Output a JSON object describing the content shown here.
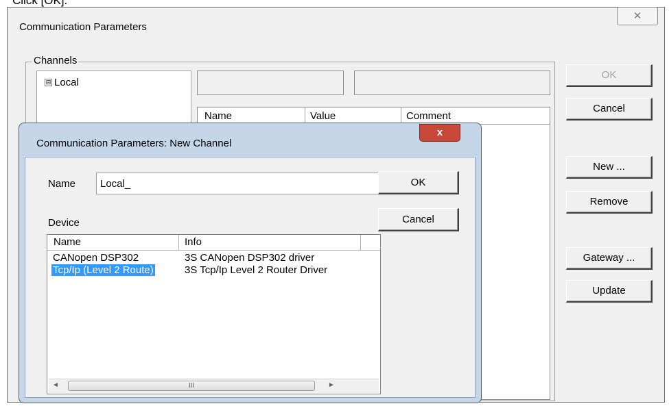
{
  "caption": "Click [OK].",
  "main_dialog": {
    "title": "Communication Parameters",
    "close_glyph": "✕",
    "channels_group_label": "Channels",
    "tree": {
      "expand_glyph": "⊟",
      "root": "Local"
    },
    "params_columns": [
      "Name",
      "Value",
      "Comment"
    ],
    "buttons": {
      "ok": "OK",
      "cancel": "Cancel",
      "new": "New ...",
      "remove": "Remove",
      "gateway": "Gateway ...",
      "update": "Update"
    }
  },
  "new_channel_dialog": {
    "title": "Communication Parameters: New Channel",
    "close_glyph": "x",
    "name_label": "Name",
    "name_value": "Local_",
    "device_label": "Device",
    "buttons": {
      "ok": "OK",
      "cancel": "Cancel"
    },
    "device_columns": [
      "Name",
      "Info"
    ],
    "devices": [
      {
        "name": "CANopen DSP302",
        "info": "3S CANopen DSP302 driver",
        "selected": false
      },
      {
        "name": "Tcp/Ip (Level 2 Route)",
        "info": "3S Tcp/Ip Level 2 Router Driver",
        "selected": true
      }
    ],
    "scroll": {
      "left": "◄",
      "thumb": "III",
      "right": "►"
    }
  },
  "colors": {
    "selection": "#3399ff",
    "close_red": "#c8483a",
    "window_frame": "#c5d6e8"
  }
}
